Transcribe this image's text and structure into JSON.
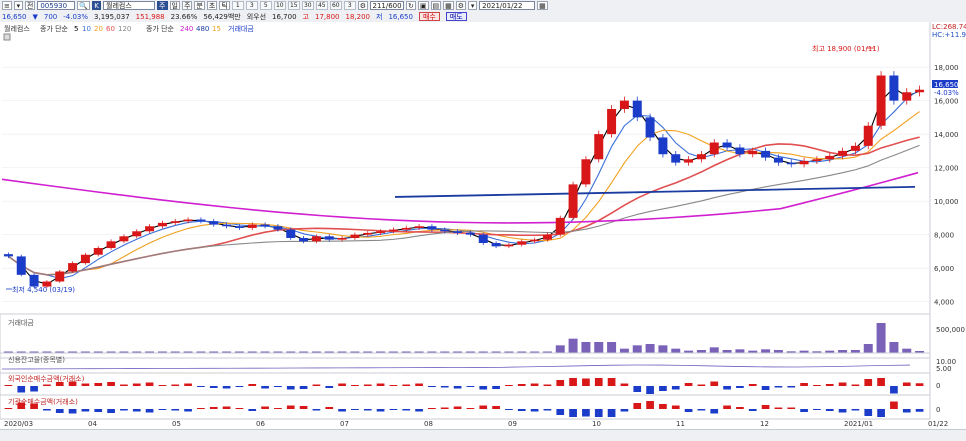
{
  "toolbar": {
    "code": "005930",
    "search_label": "전",
    "name": "월레컴스",
    "tabs": [
      "주",
      "일",
      "주",
      "분",
      "초",
      "틱"
    ],
    "periods": [
      "1",
      "3",
      "5",
      "10",
      "15",
      "30",
      "45",
      "60",
      "3"
    ],
    "count": "211/600",
    "date": "2021/01/22",
    "price": "16,650",
    "change": "700",
    "change_pct": "-4.03%",
    "volume": "3,195,037",
    "amount": "151,988",
    "ratio": "23.66%",
    "value": "56,429백만",
    "session": "외우선",
    "open": "16,700",
    "high_label": "고",
    "high": "17,800",
    "high2": "18,200",
    "low_label": "저",
    "low": "16,650",
    "buy_label": "매수",
    "sell_label": "매도"
  },
  "legend": {
    "stock": "월레컴스",
    "ma_label": "종가 단순",
    "ma_periods": [
      "5",
      "10",
      "20",
      "60",
      "120"
    ],
    "ma_colors": [
      "#000000",
      "#3a6fd8",
      "#f0a020",
      "#e05050",
      "#888888"
    ],
    "ma2_label": "종가 단순",
    "ma2_periods": [
      "240",
      "480",
      "15"
    ],
    "ma2_colors": [
      "#d020d0",
      "#1a3ca0",
      "#f0a020"
    ],
    "volume_label": "거래대금",
    "top_right_1": "LC:268.74",
    "top_right_2": "HC:+11.90"
  },
  "annotations": {
    "high": "최고 18,900 (01/11)",
    "low": "최저 4,540 (03/19)",
    "current_price": "16,650",
    "current_pct": "-4.03%"
  },
  "price_axis": {
    "ticks": [
      "18,000",
      "16,000",
      "14,000",
      "12,000",
      "10,000",
      "8,000",
      "6,000",
      "4,000"
    ],
    "values": [
      18000,
      16000,
      14000,
      12000,
      10000,
      8000,
      6000,
      4000
    ]
  },
  "x_axis": [
    "2020/03",
    "04",
    "05",
    "06",
    "07",
    "08",
    "09",
    "10",
    "11",
    "12",
    "2021/01",
    "01/22"
  ],
  "panels": {
    "volume": {
      "label": "거래대금",
      "tick": "500,000"
    },
    "credit": {
      "label": "신용잔고율(종목별)",
      "ticks": [
        "10.00",
        "5.00"
      ]
    },
    "foreign": {
      "label": "외국인순매수금액(거래소)",
      "tick": "0"
    },
    "institution": {
      "label": "기관순매수금액(거래소)",
      "tick": "0"
    }
  },
  "chart_data": {
    "type": "candlestick",
    "title": "월레컴스",
    "ylim": [
      3500,
      19500
    ],
    "x_start": "2020/03",
    "x_end": "2021/01/22",
    "high": {
      "value": 18900,
      "date": "01/11"
    },
    "low": {
      "value": 4540,
      "date": "03/19"
    },
    "close_series": [
      6700,
      5600,
      4900,
      5200,
      5800,
      6300,
      6800,
      7200,
      7600,
      7900,
      8200,
      8500,
      8700,
      8800,
      8900,
      8800,
      8600,
      8500,
      8400,
      8600,
      8500,
      8300,
      7800,
      7600,
      7900,
      7700,
      7800,
      8000,
      8100,
      8200,
      8300,
      8400,
      8500,
      8300,
      8200,
      8100,
      8000,
      7500,
      7300,
      7400,
      7600,
      7700,
      8000,
      9000,
      11000,
      12500,
      14000,
      15500,
      16000,
      15000,
      13800,
      12800,
      12300,
      12500,
      12800,
      13500,
      13200,
      12800,
      13000,
      12600,
      12300,
      12200,
      12400,
      12500,
      12700,
      13000,
      13300,
      14500,
      17500,
      16000,
      16500,
      16650
    ],
    "moving_averages": [
      {
        "name": "5",
        "color": "#000000"
      },
      {
        "name": "10",
        "color": "#3a6fd8"
      },
      {
        "name": "20",
        "color": "#f0a020"
      },
      {
        "name": "60",
        "color": "#e05050"
      },
      {
        "name": "120",
        "color": "#888888"
      },
      {
        "name": "240",
        "color": "#d020d0"
      },
      {
        "name": "480",
        "color": "#1a3ca0"
      }
    ]
  }
}
